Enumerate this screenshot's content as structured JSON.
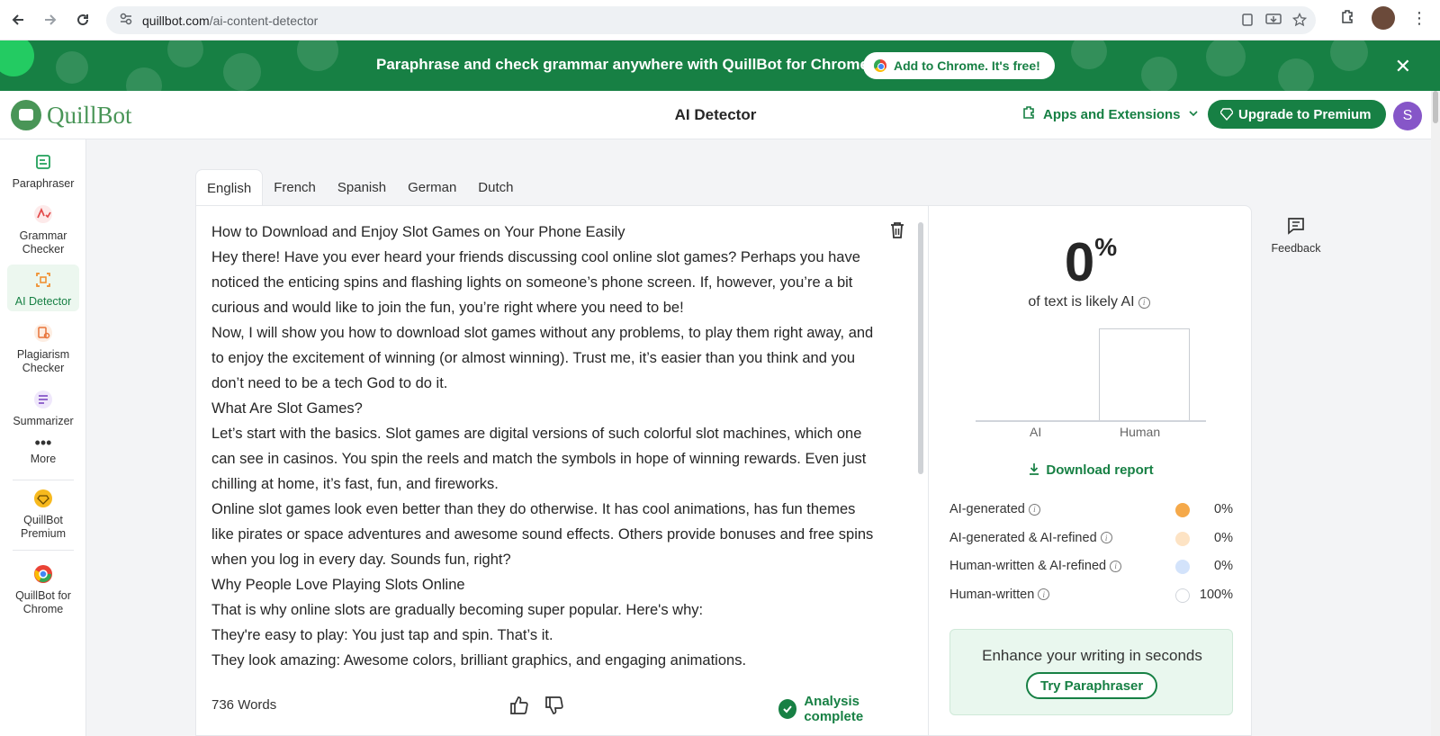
{
  "browser": {
    "url_host": "quillbot.com",
    "url_path": "/ai-content-detector"
  },
  "promo": {
    "text": "Paraphrase and check grammar anywhere with QuillBot for Chrome",
    "button_label": "Add to Chrome. It's free!"
  },
  "header": {
    "logo_text": "QuillBot",
    "title": "AI Detector",
    "apps_label": "Apps and Extensions",
    "upgrade_label": "Upgrade to Premium",
    "user_initial": "S"
  },
  "sidebar": {
    "items": [
      {
        "label": "Paraphraser",
        "icon": "paraphraser-icon"
      },
      {
        "label": "Grammar Checker",
        "icon": "grammar-checker-icon"
      },
      {
        "label": "AI Detector",
        "icon": "ai-detector-icon"
      },
      {
        "label": "Plagiarism Checker",
        "icon": "plagiarism-checker-icon"
      },
      {
        "label": "Summarizer",
        "icon": "summarizer-icon"
      },
      {
        "label": "More",
        "icon": "more-icon"
      },
      {
        "label": "QuillBot Premium",
        "icon": "premium-gem-icon"
      },
      {
        "label": "QuillBot for Chrome",
        "icon": "chrome-icon"
      }
    ]
  },
  "tabs": [
    "English",
    "French",
    "Spanish",
    "German",
    "Dutch"
  ],
  "editor": {
    "paragraphs": [
      "How to Download and Enjoy Slot Games on Your Phone Easily",
      "Hey there! Have you ever heard your friends discussing cool online slot games? Perhaps you have noticed the enticing spins and flashing lights on someone’s phone screen. If, however, you’re a bit curious and would like to join the fun, you’re right where you need to be!",
      "Now, I will show you how to download slot games without any problems, to play them right away, and to enjoy the excitement of winning (or almost winning). Trust me, it’s easier than you think and you don’t need to be a tech God to do it.",
      "What Are Slot Games?",
      "Let’s start with the basics. Slot games are digital versions of such colorful slot machines, which one can see in casinos. You spin the reels and match the symbols in hope of winning rewards. Even just chilling at home, it’s fast, fun, and fireworks.",
      "Online slot games look even better than they do otherwise. It has cool animations, has fun themes like pirates or space adventures and awesome sound effects. Others provide bonuses and free spins when you log in every day. Sounds fun, right?",
      "Why People Love Playing Slots Online",
      "That is why online slots are gradually becoming super popular. Here's why:",
      "They're easy to play: You just tap and spin. That’s it.",
      "They look amazing: Awesome colors, brilliant graphics, and engaging animations."
    ],
    "word_count": "736 Words",
    "status": "Analysis complete"
  },
  "results": {
    "ai_percent": "0",
    "percent_sign": "%",
    "caption": "of text is likely AI",
    "download_label": "Download report",
    "legend": [
      {
        "label": "AI-generated",
        "value": "0%",
        "color": "#f5a94a"
      },
      {
        "label": "AI-generated & AI-refined",
        "value": "0%",
        "color": "#fde3c4"
      },
      {
        "label": "Human-written & AI-refined",
        "value": "0%",
        "color": "#d3e3fb"
      },
      {
        "label": "Human-written",
        "value": "100%",
        "color": "#ffffff"
      }
    ],
    "enhance_title": "Enhance your writing in seconds",
    "enhance_button": "Try Paraphraser"
  },
  "chart_data": {
    "type": "bar",
    "categories": [
      "AI",
      "Human"
    ],
    "values": [
      0,
      100
    ],
    "ylim": [
      0,
      100
    ]
  },
  "feedback_label": "Feedback",
  "colors": {
    "brand_green": "#178044",
    "premium_purple": "#8656c8"
  }
}
